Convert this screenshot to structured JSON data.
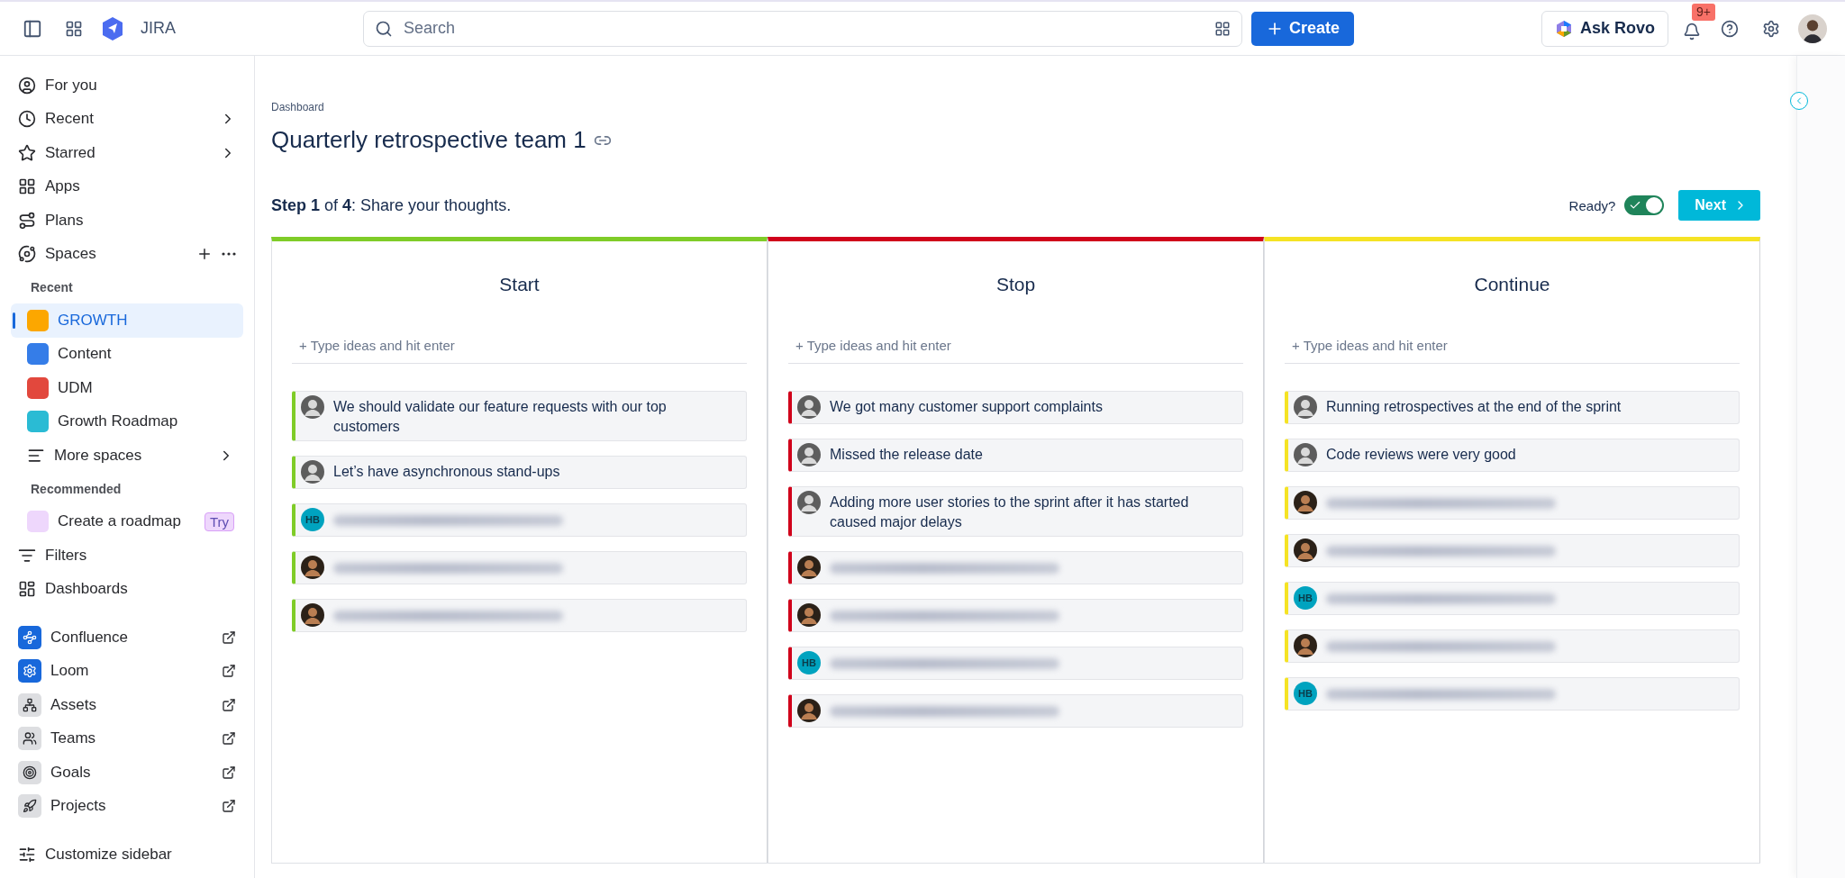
{
  "topbar": {
    "product": "JIRA",
    "search": {
      "placeholder": "Search"
    },
    "create": "Create",
    "ask": "Ask Rovo",
    "notifications": "9+"
  },
  "sidebar": {
    "nav": [
      {
        "label": "For you",
        "chevron": false
      },
      {
        "label": "Recent",
        "chevron": true
      },
      {
        "label": "Starred",
        "chevron": true
      },
      {
        "label": "Apps",
        "chevron": false
      },
      {
        "label": "Plans",
        "chevron": false
      }
    ],
    "spaces": {
      "label": "Spaces",
      "recent_heading": "Recent",
      "items": [
        {
          "label": "GROWTH",
          "selected": true
        },
        {
          "label": "Content",
          "selected": false
        },
        {
          "label": "UDM",
          "selected": false
        },
        {
          "label": "Growth Roadmap",
          "selected": false
        }
      ],
      "more": "More spaces",
      "recommended_heading": "Recommended",
      "recommended": {
        "label": "Create a roadmap",
        "badge": "Try"
      }
    },
    "nav2": [
      {
        "label": "Filters"
      },
      {
        "label": "Dashboards"
      }
    ],
    "apps": [
      {
        "label": "Confluence"
      },
      {
        "label": "Loom"
      },
      {
        "label": "Assets"
      },
      {
        "label": "Teams"
      },
      {
        "label": "Goals"
      },
      {
        "label": "Projects"
      }
    ],
    "customize": "Customize sidebar"
  },
  "breadcrumb": "Dashboard",
  "title": "Quarterly retrospective team 1",
  "step": "**Step 1** of **4**: Share your thoughts.",
  "ready": {
    "label": "Ready?",
    "on": true
  },
  "next": "Next",
  "columns": [
    {
      "title": "Start",
      "color": "#7fcc28",
      "placeholder": "+ Type ideas and hit enter",
      "cards": [
        {
          "kind": "idea",
          "avatar": {
            "kind": "photo"
          },
          "text": "We should validate our feature requests with our top customers"
        },
        {
          "kind": "idea",
          "avatar": {
            "kind": "photo"
          },
          "text": "Let’s have asynchronous stand-ups"
        },
        {
          "kind": "redacted",
          "avatar": {
            "kind": "initials",
            "initials": "HB"
          }
        },
        {
          "kind": "redacted",
          "avatar": {
            "kind": "photo"
          }
        },
        {
          "kind": "redacted",
          "avatar": {
            "kind": "photo"
          }
        }
      ]
    },
    {
      "title": "Stop",
      "color": "#d0021b",
      "placeholder": "+ Type ideas and hit enter",
      "cards": [
        {
          "kind": "idea",
          "avatar": {
            "kind": "photo"
          },
          "text": "We got many customer support complaints"
        },
        {
          "kind": "idea",
          "avatar": {
            "kind": "photo"
          },
          "text": "Missed the release date"
        },
        {
          "kind": "idea",
          "avatar": {
            "kind": "photo"
          },
          "text": "Adding more user stories to the sprint after it has started caused major delays"
        },
        {
          "kind": "redacted",
          "avatar": {
            "kind": "photo"
          }
        },
        {
          "kind": "redacted",
          "avatar": {
            "kind": "photo"
          }
        },
        {
          "kind": "redacted",
          "avatar": {
            "kind": "initials",
            "initials": "HB"
          }
        },
        {
          "kind": "redacted",
          "avatar": {
            "kind": "photo"
          }
        }
      ]
    },
    {
      "title": "Continue",
      "color": "#f5e324",
      "placeholder": "+ Type ideas and hit enter",
      "cards": [
        {
          "kind": "idea",
          "avatar": {
            "kind": "photo"
          },
          "text": "Running retrospectives at the end of the sprint"
        },
        {
          "kind": "idea",
          "avatar": {
            "kind": "photo"
          },
          "text": "Code reviews were very good"
        },
        {
          "kind": "redacted",
          "avatar": {
            "kind": "photo"
          }
        },
        {
          "kind": "redacted",
          "avatar": {
            "kind": "photo"
          }
        },
        {
          "kind": "redacted",
          "avatar": {
            "kind": "initials",
            "initials": "HB"
          }
        },
        {
          "kind": "redacted",
          "avatar": {
            "kind": "photo"
          }
        },
        {
          "kind": "redacted",
          "avatar": {
            "kind": "initials",
            "initials": "HB"
          }
        }
      ]
    }
  ]
}
